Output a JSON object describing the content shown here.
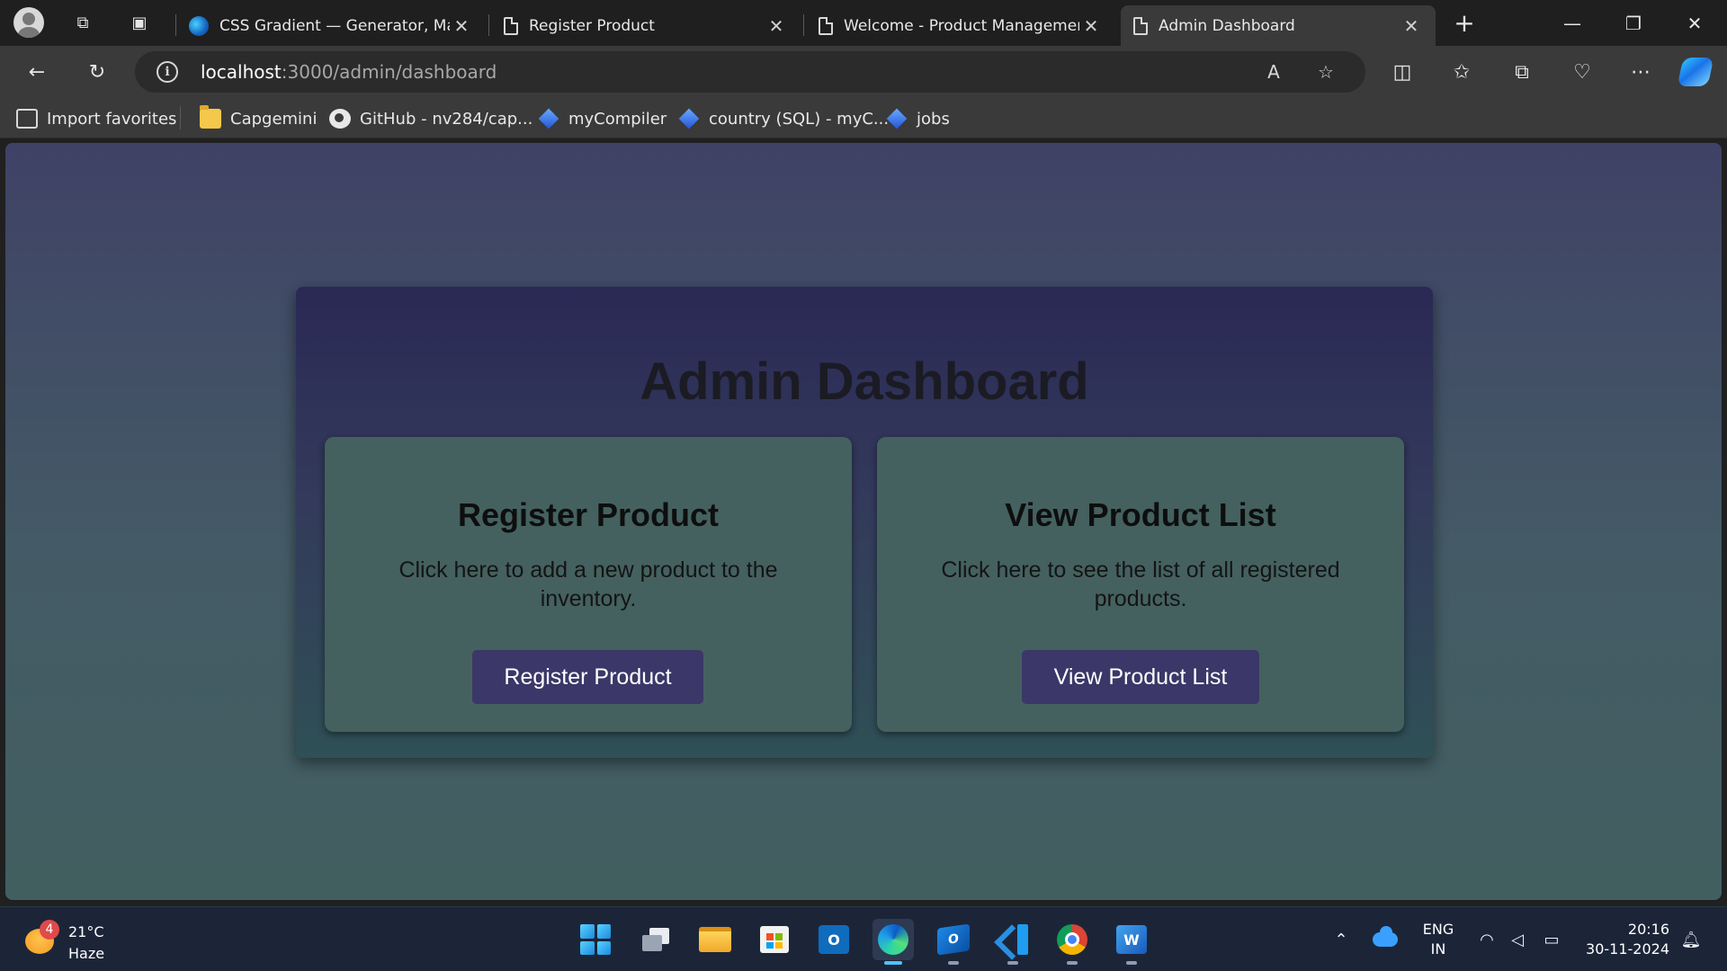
{
  "browser": {
    "tabs": [
      {
        "title": "CSS Gradient — Generator, Mak",
        "icon": "edge-icon",
        "active": false
      },
      {
        "title": "Register Product",
        "icon": "page-icon",
        "active": false
      },
      {
        "title": "Welcome - Product Managemen",
        "icon": "page-icon",
        "active": false
      },
      {
        "title": "Admin Dashboard",
        "icon": "page-icon",
        "active": true
      }
    ],
    "new_tab_symbol": "+",
    "close_symbol": "✕",
    "address": {
      "host": "localhost",
      "path": ":3000/admin/dashboard"
    },
    "favorites": [
      {
        "label": "Import favorites",
        "icon": "import-icon"
      },
      {
        "label": "Capgemini",
        "icon": "folder-icon"
      },
      {
        "label": "GitHub - nv284/cap...",
        "icon": "github-icon"
      },
      {
        "label": "myCompiler",
        "icon": "mycompiler-icon"
      },
      {
        "label": "country (SQL) - myC...",
        "icon": "mycompiler-icon"
      },
      {
        "label": "jobs",
        "icon": "mycompiler-icon"
      }
    ]
  },
  "page": {
    "title": "Admin Dashboard",
    "cards": [
      {
        "heading": "Register Product",
        "description": "Click here to add a new product to the inventory.",
        "button": "Register Product"
      },
      {
        "heading": "View Product List",
        "description": "Click here to see the list of all registered products.",
        "button": "View Product List"
      }
    ],
    "colors": {
      "background_top": "#3f4266",
      "background_bottom": "#425f60",
      "card_bg": "#44615f",
      "button_bg": "#3b3768"
    }
  },
  "taskbar": {
    "weather": {
      "temp": "21°C",
      "desc": "Haze",
      "badge": "4"
    },
    "apps": [
      "windows-start",
      "task-view",
      "file-explorer",
      "microsoft-store",
      "outlook",
      "edge",
      "new-outlook",
      "vscode",
      "chrome",
      "word"
    ],
    "language": {
      "line1": "ENG",
      "line2": "IN"
    },
    "clock": {
      "time": "20:16",
      "date": "30-11-2024"
    }
  }
}
